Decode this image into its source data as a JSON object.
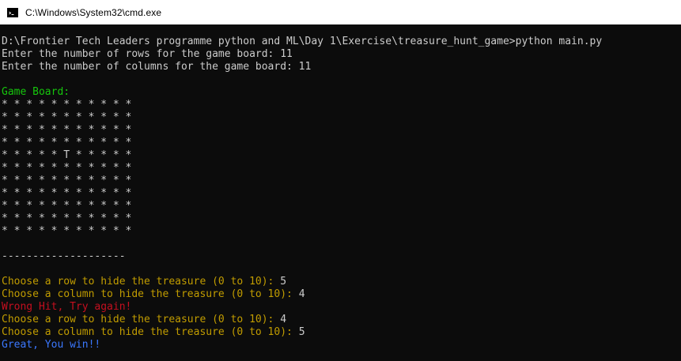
{
  "window": {
    "title": "C:\\Windows\\System32\\cmd.exe",
    "icon": "cmd-icon"
  },
  "console": {
    "command_line": "D:\\Frontier Tech Leaders programme python and ML\\Day 1\\Exercise\\treasure_hunt_game>python main.py",
    "rows_prompt": "Enter the number of rows for the game board: 11",
    "cols_prompt": "Enter the number of columns for the game board: 11",
    "board_title": "Game Board:",
    "board_rows": [
      "* * * * * * * * * * *",
      "* * * * * * * * * * *",
      "* * * * * * * * * * *",
      "* * * * * * * * * * *",
      "* * * * * T * * * * *",
      "* * * * * * * * * * *",
      "* * * * * * * * * * *",
      "* * * * * * * * * * *",
      "* * * * * * * * * * *",
      "* * * * * * * * * * *",
      "* * * * * * * * * * *"
    ],
    "separator": "--------------------",
    "hide_row_prompt_1": "Choose a row to hide the treasure (0 to 10): ",
    "hide_row_answer_1": "5",
    "hide_col_prompt_1": "Choose a column to hide the treasure (0 to 10): ",
    "hide_col_answer_1": "4",
    "wrong_hit": "Wrong Hit, Try again!",
    "hide_row_prompt_2": "Choose a row to hide the treasure (0 to 10): ",
    "hide_row_answer_2": "4",
    "hide_col_prompt_2": "Choose a column to hide the treasure (0 to 10): ",
    "hide_col_answer_2": "5",
    "win_message": "Great, You win!!"
  },
  "colors": {
    "background": "#0c0c0c",
    "text": "#cccccc",
    "green": "#16c60c",
    "yellow": "#c19c00",
    "red": "#c50f1f",
    "blue": "#3b78ff"
  }
}
